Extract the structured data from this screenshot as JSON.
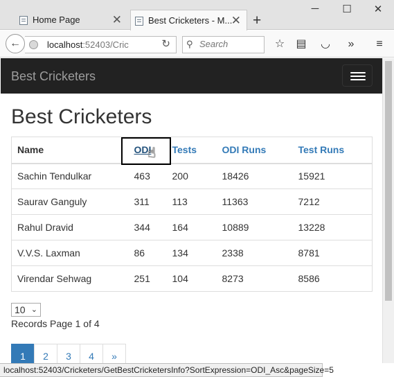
{
  "browser": {
    "tabs": [
      {
        "title": "Home Page",
        "active": false
      },
      {
        "title": "Best Cricketers - M...",
        "active": true
      }
    ],
    "url_host": "localhost",
    "url_rest": ":52403/Cric",
    "search_placeholder": "Search"
  },
  "app": {
    "brand": "Best Cricketers",
    "page_title": "Best Cricketers"
  },
  "table": {
    "columns": [
      "Name",
      "ODI",
      "Tests",
      "ODI Runs",
      "Test Runs"
    ],
    "rows": [
      [
        "Sachin Tendulkar",
        "463",
        "200",
        "18426",
        "15921"
      ],
      [
        "Saurav Ganguly",
        "311",
        "113",
        "11363",
        "7212"
      ],
      [
        "Rahul Dravid",
        "344",
        "164",
        "10889",
        "13228"
      ],
      [
        "V.V.S. Laxman",
        "86",
        "134",
        "2338",
        "8781"
      ],
      [
        "Virendar Sehwag",
        "251",
        "104",
        "8273",
        "8586"
      ]
    ]
  },
  "paging": {
    "page_size": "10",
    "info": "Records Page 1 of 4",
    "pages": [
      "1",
      "2",
      "3",
      "4",
      "»"
    ],
    "active_page": "1"
  },
  "status_url": "localhost:52403/Cricketers/GetBestCricketersInfo?SortExpression=ODI_Asc&pageSize=5"
}
